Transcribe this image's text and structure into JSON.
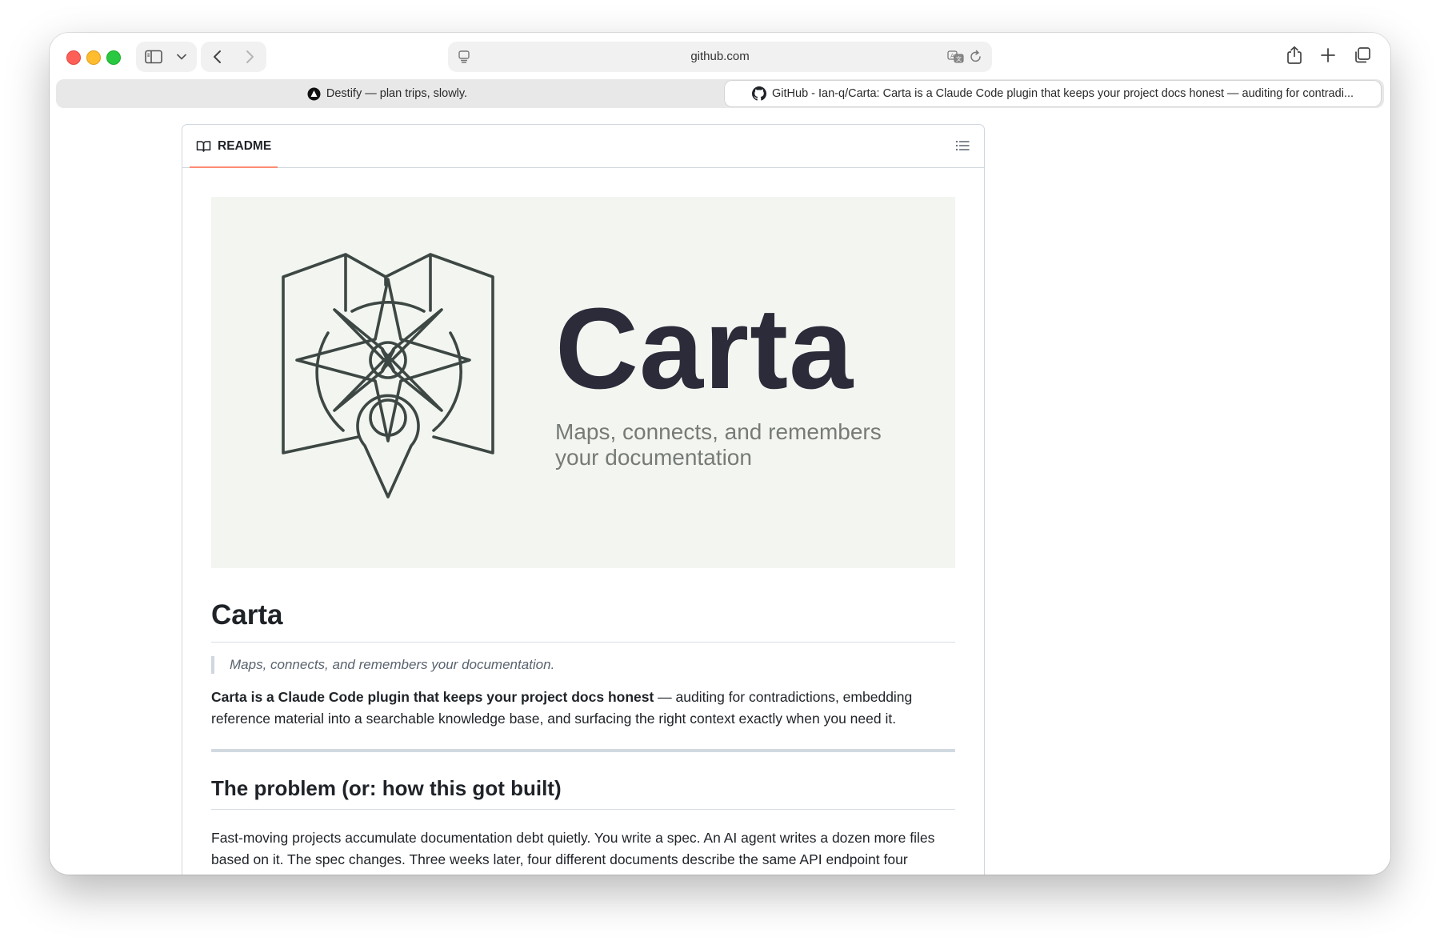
{
  "browser": {
    "url": "github.com",
    "tabs": [
      {
        "title": "Destify — plan trips, slowly.",
        "favicon": "destify-logo-icon",
        "active": false
      },
      {
        "title": "GitHub - Ian-q/Carta: Carta is a Claude Code plugin that keeps your project docs honest — auditing for contradi...",
        "favicon": "github-logo-icon",
        "active": true
      }
    ],
    "icons": [
      "sidebar-icon",
      "chevron-down-icon",
      "back-icon",
      "forward-icon",
      "page-menu-icon",
      "translate-icon",
      "reload-icon",
      "share-icon",
      "new-tab-icon",
      "tab-overview-icon"
    ]
  },
  "readme": {
    "tab_label": "README",
    "toc_icon": "list-icon",
    "banner": {
      "name": "Carta",
      "tagline": "Maps, connects, and remembers your documentation"
    },
    "title": "Carta",
    "blockquote": "Maps, connects, and remembers your documentation.",
    "intro_bold": "Carta is a Claude Code plugin that keeps your project docs honest",
    "intro_rest": " — auditing for contradictions, embedding reference material into a searchable knowledge base, and surfacing the right context exactly when you need it.",
    "section_heading": "The problem (or: how this got built)",
    "section_text": "Fast-moving projects accumulate documentation debt quietly. You write a spec. An AI agent writes a dozen more files based on it. The spec changes. Three weeks later, four different documents describe the same API endpoint four different ways, and nobody — human or AI — knows which one is right."
  },
  "colors": {
    "accent_underline": "#fd8c73",
    "banner_bg": "#f3f6f0",
    "logo_stroke": "#3d4744",
    "banner_name": "#2b2b3a"
  }
}
